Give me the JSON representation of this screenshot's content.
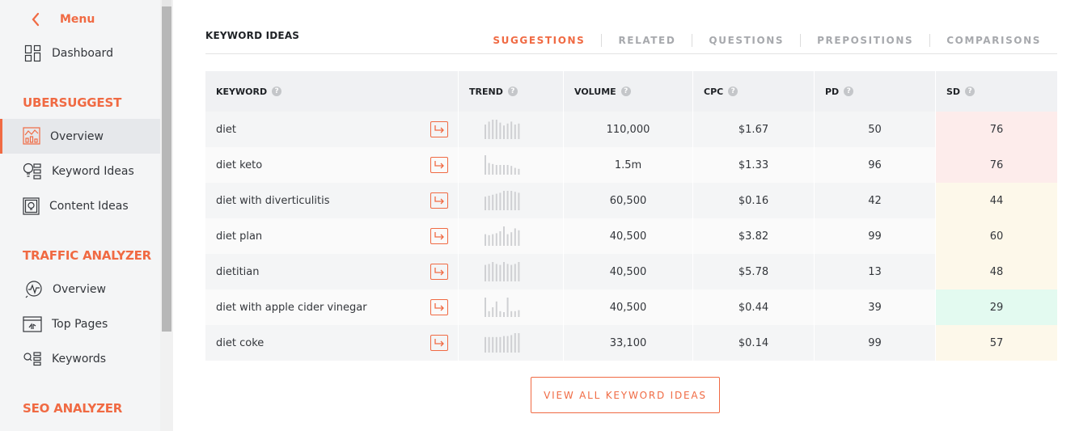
{
  "sidebar": {
    "menu_label": "Menu",
    "dashboard": "Dashboard",
    "sections": [
      {
        "title": "UBERSUGGEST",
        "items": [
          "Overview",
          "Keyword Ideas",
          "Content Ideas"
        ]
      },
      {
        "title": "TRAFFIC ANALYZER",
        "items": [
          "Overview",
          "Top Pages",
          "Keywords"
        ]
      },
      {
        "title": "SEO ANALYZER",
        "items": []
      }
    ],
    "active_item": "ubersuggest-overview"
  },
  "panel": {
    "title": "KEYWORD IDEAS",
    "tabs": [
      "SUGGESTIONS",
      "RELATED",
      "QUESTIONS",
      "PREPOSITIONS",
      "COMPARISONS"
    ],
    "active_tab": "SUGGESTIONS"
  },
  "table": {
    "columns": [
      "KEYWORD",
      "TREND",
      "VOLUME",
      "CPC",
      "PD",
      "SD"
    ],
    "help_glyph": "?",
    "rows": [
      {
        "keyword": "diet",
        "trend": [
          0.75,
          0.9,
          1,
          1,
          0.85,
          0.7,
          0.8,
          0.9,
          0.75,
          0.8
        ],
        "volume": "110,000",
        "cpc": "$1.67",
        "pd": "50",
        "sd": "76",
        "sd_color": "#fdeceb"
      },
      {
        "keyword": "diet keto",
        "trend": [
          1,
          0.6,
          0.55,
          0.5,
          0.5,
          0.5,
          0.5,
          0.45,
          0.35,
          0.3
        ],
        "volume": "1.5m",
        "cpc": "$1.33",
        "pd": "96",
        "sd": "76",
        "sd_color": "#fdeceb"
      },
      {
        "keyword": "diet with diverticulitis",
        "trend": [
          0.7,
          0.75,
          0.8,
          0.85,
          0.9,
          1,
          1,
          1,
          0.95,
          0.9
        ],
        "volume": "60,500",
        "cpc": "$0.16",
        "pd": "42",
        "sd": "44",
        "sd_color": "#fdf8ea"
      },
      {
        "keyword": "diet plan",
        "trend": [
          0.6,
          0.55,
          0.6,
          0.65,
          0.75,
          1,
          0.6,
          0.7,
          0.9,
          0.8
        ],
        "volume": "40,500",
        "cpc": "$3.82",
        "pd": "99",
        "sd": "60",
        "sd_color": "#fdf8ea"
      },
      {
        "keyword": "dietitian",
        "trend": [
          0.85,
          0.9,
          1,
          0.9,
          0.85,
          1,
          0.9,
          0.85,
          0.9,
          1
        ],
        "volume": "40,500",
        "cpc": "$5.78",
        "pd": "13",
        "sd": "48",
        "sd_color": "#fdf8ea"
      },
      {
        "keyword": "diet with apple cider vinegar",
        "trend": [
          1,
          0.3,
          0.5,
          0.8,
          0.3,
          0.25,
          1,
          0.3,
          0.3,
          0.35
        ],
        "volume": "40,500",
        "cpc": "$0.44",
        "pd": "39",
        "sd": "29",
        "sd_color": "#e3faf0"
      },
      {
        "keyword": "diet coke",
        "trend": [
          0.8,
          0.8,
          0.8,
          0.8,
          0.8,
          0.85,
          0.85,
          0.9,
          1,
          1
        ],
        "volume": "33,100",
        "cpc": "$0.14",
        "pd": "99",
        "sd": "57",
        "sd_color": "#fdf8ea"
      }
    ]
  },
  "view_all_label": "VIEW ALL KEYWORD IDEAS",
  "colors": {
    "accent": "#f06a43",
    "text": "#33363b",
    "trend_bar": "#cfd0d3"
  }
}
